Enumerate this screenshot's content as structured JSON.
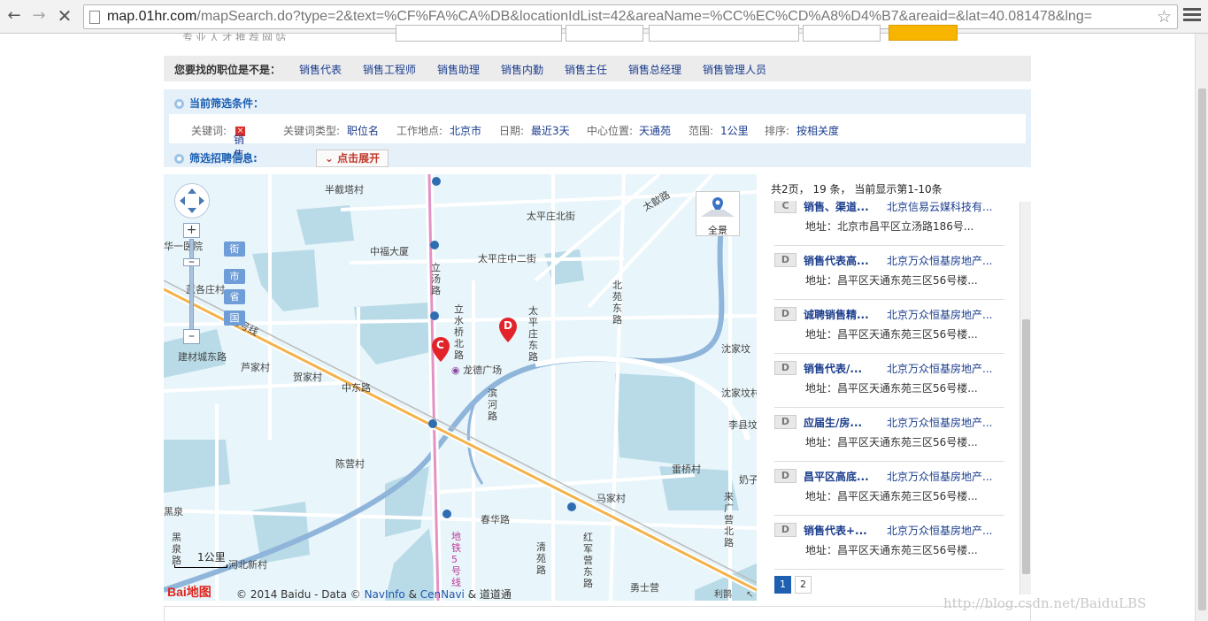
{
  "browser": {
    "url_host": "map.01hr.com",
    "url_path": "/mapSearch.do?type=2&text=%CF%FA%CA%DB&locationIdList=42&areaName=%CC%EC%CD%A8%D4%B7&areaid=&lat=40.081478&lng="
  },
  "header": {
    "slogan": "专业人才推荐网站",
    "search_button_color": "#f7b500"
  },
  "suggest": {
    "question": "您要找的职位是不是：",
    "items": [
      "销售代表",
      "销售工程师",
      "销售助理",
      "销售内勤",
      "销售主任",
      "销售总经理",
      "销售管理人员"
    ]
  },
  "filter": {
    "current_title": "当前筛选条件：",
    "conditions": [
      {
        "label": "关键词:",
        "value": "销售"
      },
      {
        "label": "关键词类型:",
        "value": "职位名"
      },
      {
        "label": "工作地点:",
        "value": "北京市"
      },
      {
        "label": "日期:",
        "value": "最近3天"
      },
      {
        "label": "中心位置:",
        "value": "天通苑"
      },
      {
        "label": "范围:",
        "value": "1公里"
      },
      {
        "label": "排序:",
        "value": "按相关度"
      }
    ],
    "screen_title": "筛选招聘信息:",
    "expand_label": "点击展开"
  },
  "map": {
    "panorama_label": "全景",
    "zoom_tags": [
      "街",
      "市",
      "省",
      "国"
    ],
    "places": {
      "banjieta": "半截塔村",
      "taipingzhuangbeijie": "太平庄北街",
      "taiyuelu": "太歙路",
      "zhongfu": "中福大厦",
      "taipingzhuang2": "太平庄中二街",
      "hua1": "华一医院",
      "lanqi": "蓝各庄村",
      "jiancai": "建材城东路",
      "lujia": "芦家村",
      "hejia": "贺家村",
      "zhongdong": "中东路",
      "longde": "龙德广场",
      "shenjiafen": "沈家坟",
      "shenjiafen2": "沈家坟村",
      "lixian": "李县坟",
      "chenying": "陈营村",
      "leiqiao": "雷桥村",
      "majia": "马家村",
      "chunhua": "春华路",
      "yongshiying": "勇士营",
      "heiquan": "黑泉",
      "hebeixin": "河北新村",
      "naizi": "奶子",
      "liyuan": "利鹊"
    },
    "vertical_roads": {
      "litang": "立汤路",
      "lishuiqiao": "立水桥北路",
      "taipingzhuangdong": "太平庄东路",
      "beiyuandong": "北苑东路",
      "binhe": "滨河路",
      "laiguangying": "来广营北路",
      "qingyuan": "清苑路",
      "heiquan_rd": "黑泉路",
      "subway": "地铁5号线",
      "hongjun": "红军营东路"
    },
    "highway_label": "13号线",
    "markers": [
      "C",
      "D"
    ],
    "scale_label": "1公里",
    "logo": "Bai地图",
    "copyright_pre": "© 2014 Baidu - Data ©",
    "copyright_link1": "NavInfo",
    "copyright_amp1": "&",
    "copyright_link2": "CenNavi",
    "copyright_amp2": "&",
    "copyright_link3": "道道通"
  },
  "results": {
    "summary": "共2页， 19 条，    当前显示第1-10条",
    "items": [
      {
        "badge": "C",
        "title": "销售、渠道...",
        "company": "北京信易云媒科技有...",
        "addr": "地址：北京市昌平区立汤路186号..."
      },
      {
        "badge": "D",
        "title": "销售代表高...",
        "company": "北京万众恒基房地产...",
        "addr": "地址：昌平区天通东苑三区56号楼..."
      },
      {
        "badge": "D",
        "title": "诚聘销售精...",
        "company": "北京万众恒基房地产...",
        "addr": "地址：昌平区天通东苑三区56号楼..."
      },
      {
        "badge": "D",
        "title": "销售代表/...",
        "company": "北京万众恒基房地产...",
        "addr": "地址：昌平区天通东苑三区56号楼..."
      },
      {
        "badge": "D",
        "title": "应届生/房...",
        "company": "北京万众恒基房地产...",
        "addr": "地址：昌平区天通东苑三区56号楼..."
      },
      {
        "badge": "D",
        "title": "昌平区高底...",
        "company": "北京万众恒基房地产...",
        "addr": "地址：昌平区天通东苑三区56号楼..."
      },
      {
        "badge": "D",
        "title": "销售代表+...",
        "company": "北京万众恒基房地产...",
        "addr": "地址：昌平区天通东苑三区56号楼..."
      }
    ],
    "pages": [
      "1",
      "2"
    ]
  },
  "watermark": "http://blog.csdn.net/BaiduLBS"
}
